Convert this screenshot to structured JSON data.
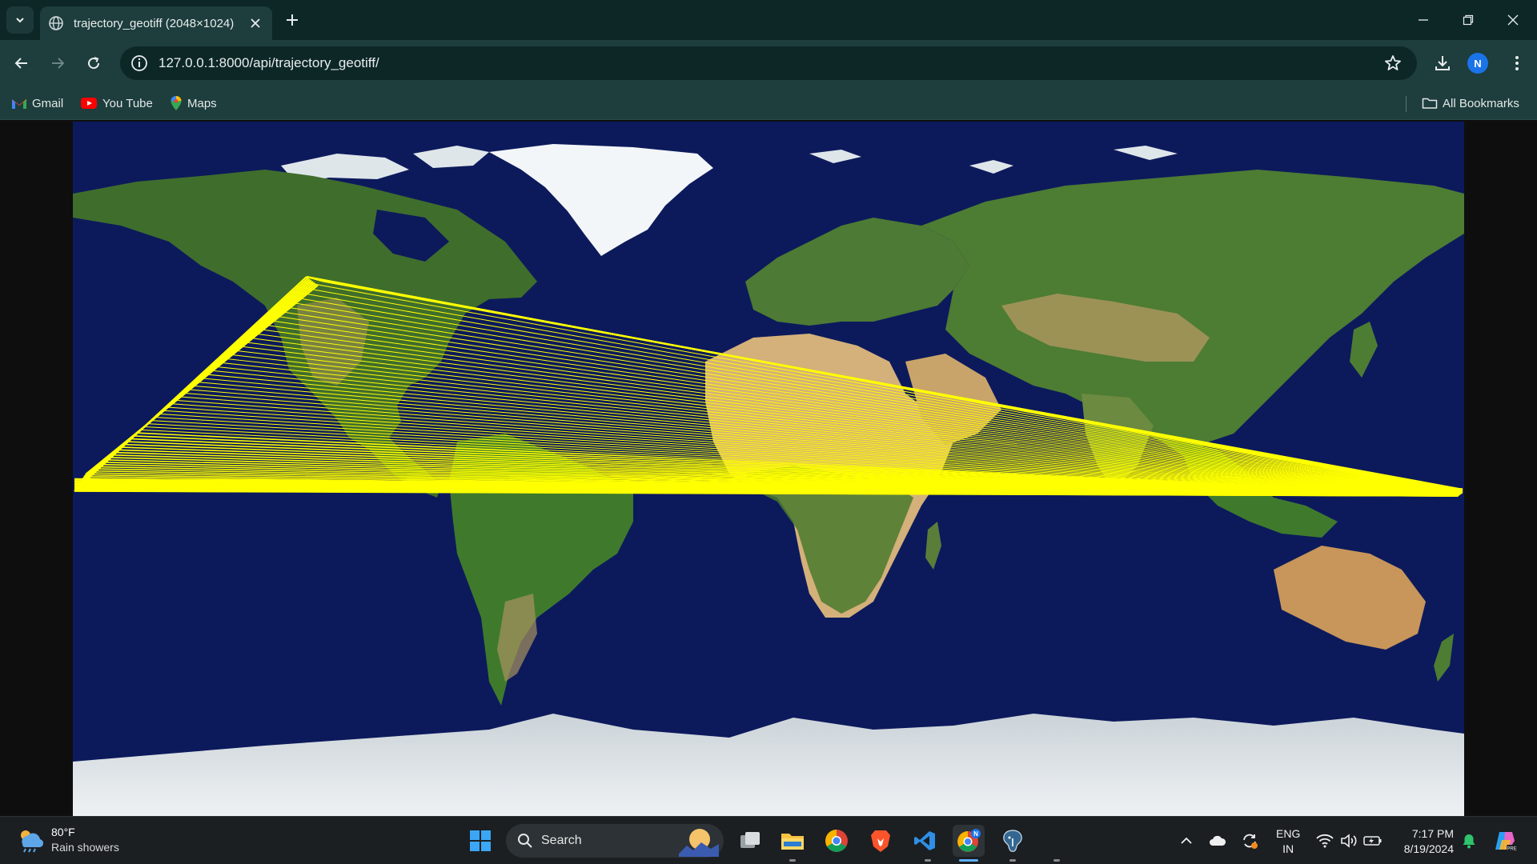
{
  "browser": {
    "tab_title": "trajectory_geotiff (2048×1024)",
    "url": "127.0.0.1:8000/api/trajectory_geotiff/",
    "profile_initial": "N",
    "bookmarks": [
      {
        "label": "Gmail",
        "icon": "gmail-icon"
      },
      {
        "label": "You Tube",
        "icon": "youtube-icon"
      },
      {
        "label": "Maps",
        "icon": "maps-icon"
      }
    ],
    "all_bookmarks_label": "All Bookmarks"
  },
  "content": {
    "image": "world-satellite-map-with-trajectory-lines",
    "trajectory_color": "#ffff00"
  },
  "taskbar": {
    "weather_temp": "80°F",
    "weather_condition": "Rain showers",
    "search_label": "Search",
    "apps": [
      "start-icon",
      "search-icon",
      "task-view-icon",
      "file-explorer-icon",
      "chrome-icon",
      "brave-icon",
      "vscode-icon",
      "chrome-profile-icon",
      "postgresql-icon"
    ],
    "lang_line1": "ENG",
    "lang_line2": "IN",
    "time": "7:17 PM",
    "date": "8/19/2024"
  },
  "colors": {
    "chrome_dark": "#0d2727",
    "chrome_toolbar": "#1e3d3d",
    "ocean": "#0c1a5c",
    "land": "#3d6b2a",
    "desert": "#c9a46a",
    "ice": "#eef1f4"
  }
}
